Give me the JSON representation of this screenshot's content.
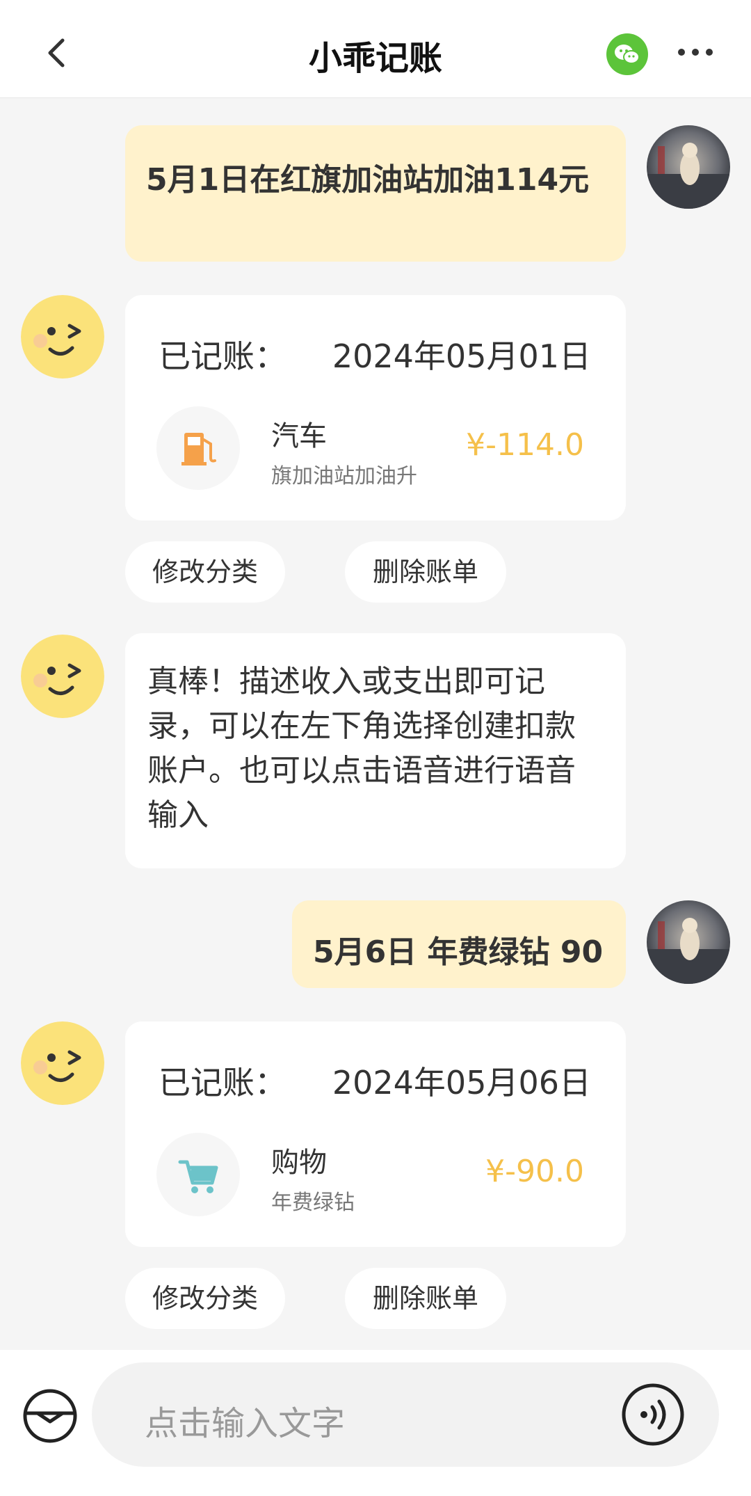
{
  "header": {
    "title": "小乖记账"
  },
  "messages": {
    "user1": "5月1日在红旗加油站加油114元",
    "record1": {
      "label": "已记账：",
      "date": "2024年05月01日",
      "category": "汽车",
      "description": "旗加油站加油升",
      "amount": "¥-114.0",
      "icon": "fuel-pump-icon"
    },
    "actions1": {
      "edit": "修改分类",
      "delete": "删除账单"
    },
    "bot_reply": "真棒！描述收入或支出即可记录，可以在左下角选择创建扣款账户。也可以点击语音进行语音输入",
    "user2": "5月6日 年费绿钻 90",
    "record2": {
      "label": "已记账：",
      "date": "2024年05月06日",
      "category": "购物",
      "description": "年费绿钻",
      "amount": "¥-90.0",
      "icon": "shopping-cart-icon"
    },
    "actions2": {
      "edit": "修改分类",
      "delete": "删除账单"
    }
  },
  "input": {
    "placeholder": "点击输入文字"
  },
  "colors": {
    "user_bubble": "#fff2cc",
    "amount": "#f5c04a",
    "wechat": "#5cc43a",
    "fuel_icon": "#f5a14a",
    "cart_icon": "#6cc3c9"
  }
}
